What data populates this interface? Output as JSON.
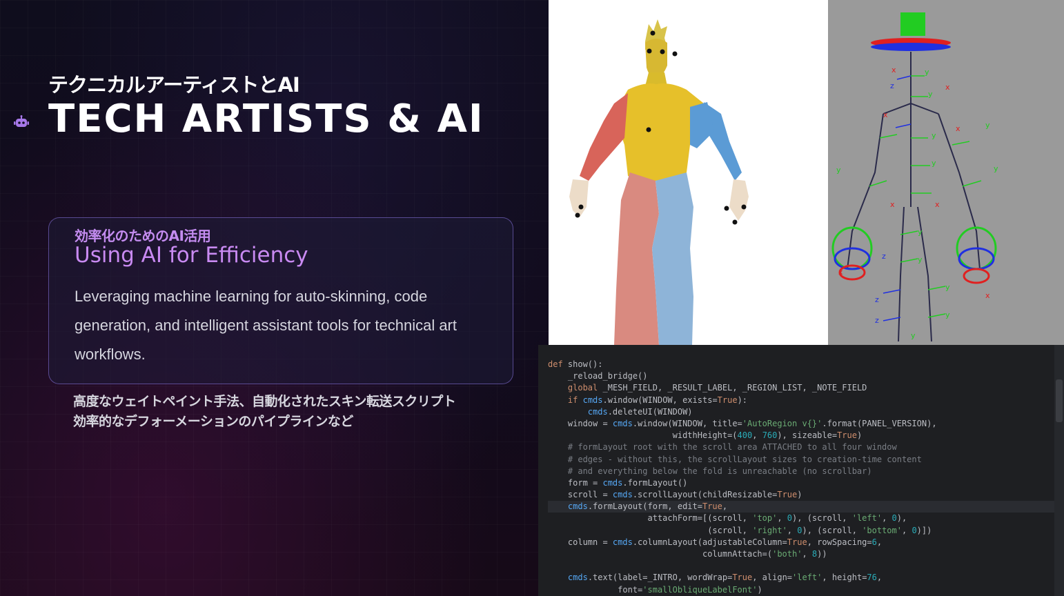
{
  "slide": {
    "title_jp": "テクニカルアーティストとAI",
    "title_en": "TECH ARTISTS & AI",
    "icon": "robot-icon",
    "card": {
      "heading_jp": "効率化のためのAI活用",
      "heading_en": "Using AI for Efficiency",
      "body": "Leveraging machine learning for auto-skinning, code generation, and intelligent assistant tools for technical art workflows."
    },
    "bottom_jp_line1": "高度なウェイトペイント手法、自動化されたスキン転送スクリプト",
    "bottom_jp_line2": "効率的なデフォーメーションのパイプラインなど"
  },
  "colors": {
    "accent_purple": "#c98af2",
    "skin_yellow": "#e6c02a",
    "skin_red": "#d8645a",
    "skin_blue": "#5b9bd5",
    "rig_green": "#22cc22",
    "rig_red": "#e02020",
    "rig_blue": "#2030e0"
  },
  "rig_axis_labels": {
    "x": "x",
    "y": "y",
    "z": "z"
  },
  "code": [
    "def show():",
    "    _reload_bridge()",
    "    global _MESH_FIELD, _RESULT_LABEL, _REGION_LIST, _NOTE_FIELD",
    "    if cmds.window(WINDOW, exists=True):",
    "        cmds.deleteUI(WINDOW)",
    "    window = cmds.window(WINDOW, title='AutoRegion v{}'.format(PANEL_VERSION),",
    "                         widthHeight=(400, 760), sizeable=True)",
    "    # formLayout root with the scroll area ATTACHED to all four window",
    "    # edges - without this, the scrollLayout sizes to creation-time content",
    "    # and everything below the fold is unreachable (no scrollbar)",
    "    form = cmds.formLayout()",
    "    scroll = cmds.scrollLayout(childResizable=True)",
    "    cmds.formLayout(form, edit=True,",
    "                    attachForm=[(scroll, 'top', 0), (scroll, 'left', 0),",
    "                                (scroll, 'right', 0), (scroll, 'bottom', 0)])",
    "    column = cmds.columnLayout(adjustableColumn=True, rowSpacing=6,",
    "                               columnAttach=('both', 8))",
    "",
    "    cmds.text(label=_INTRO, wordWrap=True, align='left', height=76,",
    "              font='smallObliqueLabelFont')"
  ]
}
